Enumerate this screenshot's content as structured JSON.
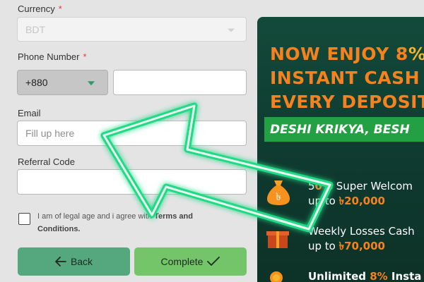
{
  "form": {
    "currency": {
      "label": "Currency",
      "required_mark": "*",
      "value": "BDT"
    },
    "phone": {
      "label": "Phone Number",
      "required_mark": "*",
      "dial_code": "+880",
      "value": ""
    },
    "email": {
      "label": "Email",
      "placeholder": "Fill up here",
      "value": ""
    },
    "referral": {
      "label": "Referral Code",
      "value": ""
    },
    "agree": {
      "text": "I am of legal age and i agree with",
      "terms_link": "Terms and Conditions."
    },
    "back_label": "Back",
    "complete_label": "Complete"
  },
  "promo": {
    "headline_line1": "NOW ENJOY 8",
    "headline_line1_highlight": "%",
    "headline_line2": "INSTANT CASH",
    "headline_line3": "EVERY DEPOSIT",
    "banner": "DESHI KRIKYA, BESH",
    "features": [
      {
        "icon": "money-bag-icon",
        "prefix": "5",
        "percent": "0%",
        "text": " Super Welcom",
        "line2_prefix": "up to ",
        "amount": "৳20,000"
      },
      {
        "icon": "gift-box-icon",
        "prefix": "",
        "percent": "",
        "text": "Weekly Losses Cash",
        "line2_prefix": "up to ",
        "amount": "৳70,000"
      },
      {
        "icon": "coin-icon",
        "prefix": "Unlimited ",
        "percent": "8%",
        "text": " Insta",
        "line2_prefix": "",
        "amount": ""
      }
    ]
  },
  "colors": {
    "accent_green": "#74c46a",
    "back_green": "#55a77e",
    "neon_arrow": "#3dff9a",
    "promo_orange": "#f6821f"
  }
}
